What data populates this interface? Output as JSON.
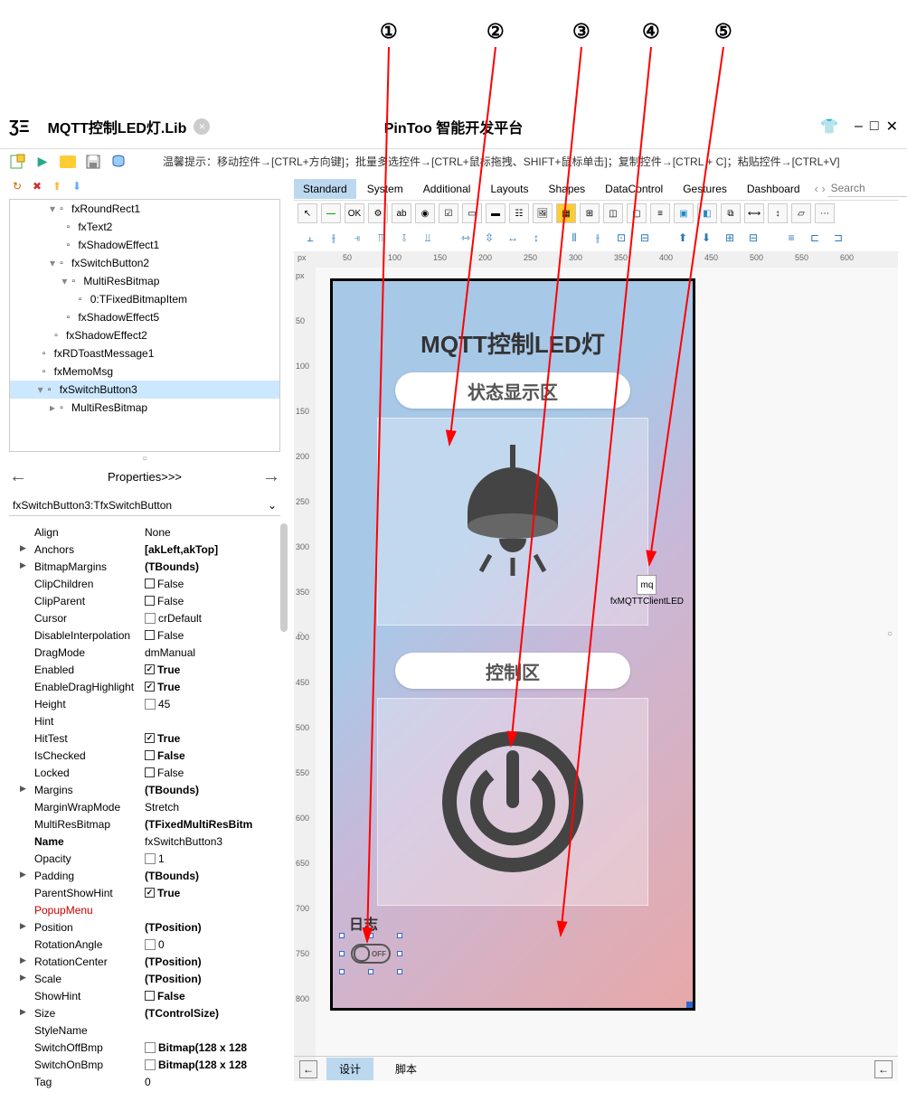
{
  "annotations": [
    "①",
    "②",
    "③",
    "④",
    "⑤"
  ],
  "doc_title": "MQTT控制LED灯.Lib",
  "app_title": "PinToo 智能开发平台",
  "hint": "温馨提示：移动控件→[CTRL+方向键]；批量多选控件→[CTRL+鼠标拖拽、SHIFT+鼠标单击]；复制控件→[CTRL + C]；粘贴控件→[CTRL+V]",
  "palette_tabs": [
    "Standard",
    "System",
    "Additional",
    "Layouts",
    "Shapes",
    "DataControl",
    "Gestures",
    "Dashboard"
  ],
  "search_placeholder": "Search",
  "tree": [
    {
      "indent": 3,
      "icon": "rect",
      "label": "fxRoundRect1",
      "exp": "▾"
    },
    {
      "indent": 4,
      "icon": "txt",
      "label": "fxText2"
    },
    {
      "indent": 4,
      "icon": "fx",
      "label": "fxShadowEffect1"
    },
    {
      "indent": 3,
      "icon": "btn",
      "label": "fxSwitchButton2",
      "exp": "▾"
    },
    {
      "indent": 4,
      "icon": "bmp",
      "label": "MultiResBitmap",
      "exp": "▾"
    },
    {
      "indent": 5,
      "icon": "pin",
      "label": "0:TFixedBitmapItem"
    },
    {
      "indent": 4,
      "icon": "fx",
      "label": "fxShadowEffect5"
    },
    {
      "indent": 3,
      "icon": "fx",
      "label": "fxShadowEffect2"
    },
    {
      "indent": 2,
      "icon": "msg",
      "label": "fxRDToastMessage1"
    },
    {
      "indent": 2,
      "icon": "memo",
      "label": "fxMemoMsg"
    },
    {
      "indent": 2,
      "icon": "btn",
      "label": "fxSwitchButton3",
      "selected": true,
      "exp": "▾"
    },
    {
      "indent": 3,
      "icon": "bmp",
      "label": "MultiResBitmap",
      "exp": "▸"
    }
  ],
  "props_nav": "Properties>>>",
  "obj_selector": "fxSwitchButton3:TfxSwitchButton",
  "props": [
    {
      "k": "Align",
      "v": "None"
    },
    {
      "k": "Anchors",
      "v": "[akLeft,akTop]",
      "exp": true,
      "bold": true
    },
    {
      "k": "BitmapMargins",
      "v": "(TBounds)",
      "exp": true,
      "bold": true
    },
    {
      "k": "ClipChildren",
      "v": "False",
      "cb": false
    },
    {
      "k": "ClipParent",
      "v": "False",
      "cb": false
    },
    {
      "k": "Cursor",
      "v": "crDefault",
      "icon": true
    },
    {
      "k": "DisableInterpolation",
      "v": "False",
      "cb": false
    },
    {
      "k": "DragMode",
      "v": "dmManual"
    },
    {
      "k": "Enabled",
      "v": "True",
      "cb": true,
      "bold": true
    },
    {
      "k": "EnableDragHighlight",
      "v": "True",
      "cb": true,
      "bold": true
    },
    {
      "k": "Height",
      "v": "45",
      "icon": true
    },
    {
      "k": "Hint",
      "v": ""
    },
    {
      "k": "HitTest",
      "v": "True",
      "cb": true,
      "bold": true
    },
    {
      "k": "IsChecked",
      "v": "False",
      "cb": false,
      "bold": true
    },
    {
      "k": "Locked",
      "v": "False",
      "cb": false
    },
    {
      "k": "Margins",
      "v": "(TBounds)",
      "exp": true,
      "bold": true
    },
    {
      "k": "MarginWrapMode",
      "v": "Stretch"
    },
    {
      "k": "MultiResBitmap",
      "v": "(TFixedMultiResBitm",
      "bold": true
    },
    {
      "k": "Name",
      "v": "fxSwitchButton3",
      "kbold": true
    },
    {
      "k": "Opacity",
      "v": "1",
      "icon": true
    },
    {
      "k": "Padding",
      "v": "(TBounds)",
      "exp": true,
      "bold": true
    },
    {
      "k": "ParentShowHint",
      "v": "True",
      "cb": true,
      "bold": true
    },
    {
      "k": "PopupMenu",
      "v": "",
      "red": true
    },
    {
      "k": "Position",
      "v": "(TPosition)",
      "exp": true,
      "bold": true
    },
    {
      "k": "RotationAngle",
      "v": "0",
      "icon": true
    },
    {
      "k": "RotationCenter",
      "v": "(TPosition)",
      "exp": true,
      "bold": true
    },
    {
      "k": "Scale",
      "v": "(TPosition)",
      "exp": true,
      "bold": true
    },
    {
      "k": "ShowHint",
      "v": "False",
      "cb": false,
      "bold": true
    },
    {
      "k": "Size",
      "v": "(TControlSize)",
      "exp": true,
      "bold": true
    },
    {
      "k": "StyleName",
      "v": ""
    },
    {
      "k": "SwitchOffBmp",
      "v": "Bitmap(128 x 128",
      "icon": true,
      "bold": true
    },
    {
      "k": "SwitchOnBmp",
      "v": "Bitmap(128 x 128",
      "icon": true,
      "bold": true
    },
    {
      "k": "Tag",
      "v": "0"
    }
  ],
  "phone": {
    "title": "MQTT控制LED灯",
    "status_hdr": "状态显示区",
    "control_hdr": "控制区",
    "mq_label": "mq",
    "mq_client": "fxMQTTClientLED",
    "log_label": "日志",
    "off_label": "OFF"
  },
  "ruler_h": [
    "px",
    "50",
    "100",
    "150",
    "200",
    "250",
    "300",
    "350",
    "400",
    "450",
    "500",
    "550",
    "600"
  ],
  "ruler_v": [
    "px",
    "50",
    "100",
    "150",
    "200",
    "250",
    "300",
    "350",
    "400",
    "450",
    "500",
    "550",
    "600",
    "650",
    "700",
    "750",
    "800"
  ],
  "bottom_tabs": {
    "design": "设计",
    "script": "脚本"
  }
}
